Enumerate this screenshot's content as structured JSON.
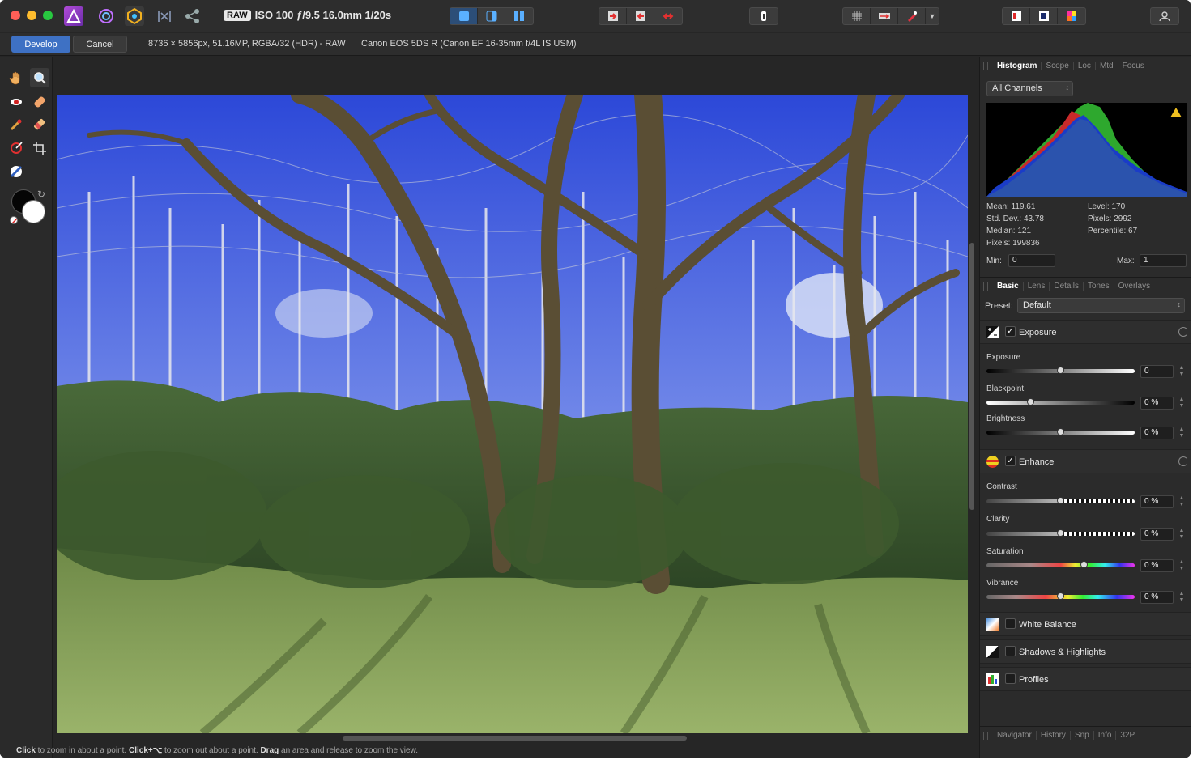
{
  "titlebar": {
    "raw_badge": "RAW",
    "exif": "ISO 100 ƒ/9.5 16.0mm 1/20s"
  },
  "context": {
    "develop_label": "Develop",
    "cancel_label": "Cancel",
    "image_info": "8736 × 5856px, 51.16MP, RGBA/32 (HDR) - RAW",
    "camera_info": "Canon EOS 5DS R (Canon EF 16-35mm f/4L IS USM)"
  },
  "histogram_panel": {
    "tabs": [
      "Histogram",
      "Scope",
      "Loc",
      "Mtd",
      "Focus"
    ],
    "channel": "All Channels",
    "stats_left": [
      "Mean: 119.61",
      "Std. Dev.: 43.78",
      "Median: 121",
      "Pixels: 199836"
    ],
    "stats_right": [
      "Level: 170",
      "Pixels: 2992",
      "Percentile: 67"
    ],
    "min_label": "Min:",
    "min_value": "0",
    "max_label": "Max:",
    "max_value": "1"
  },
  "basic_panel": {
    "tabs": [
      "Basic",
      "Lens",
      "Details",
      "Tones",
      "Overlays"
    ],
    "preset_label": "Preset:",
    "preset_value": "Default",
    "exposure_group": "Exposure",
    "exposure_check": "✓",
    "exposure": {
      "label": "Exposure",
      "value": "0",
      "level": 0.5
    },
    "blackpoint": {
      "label": "Blackpoint",
      "value": "0 %",
      "level": 0.3
    },
    "brightness": {
      "label": "Brightness",
      "value": "0 %",
      "level": 0.5
    },
    "enhance_group": "Enhance",
    "enhance_check": "✓",
    "contrast": {
      "label": "Contrast",
      "value": "0 %",
      "level": 0.5
    },
    "clarity": {
      "label": "Clarity",
      "value": "0 %",
      "level": 0.5
    },
    "saturation": {
      "label": "Saturation",
      "value": "0 %",
      "level": 0.66
    },
    "vibrance": {
      "label": "Vibrance",
      "value": "0 %",
      "level": 0.5
    },
    "white_balance": "White Balance",
    "shadows_highlights": "Shadows & Highlights",
    "profiles": "Profiles"
  },
  "bottom_tabs": [
    "Navigator",
    "History",
    "Snp",
    "Info",
    "32P"
  ],
  "status": {
    "part1_bold": "Click",
    "part1": " to zoom in about a point. ",
    "part2_bold": "Click+⌥",
    "part2": " to zoom out about a point. ",
    "part3_bold": "Drag",
    "part3": " an area and release to zoom the view."
  }
}
